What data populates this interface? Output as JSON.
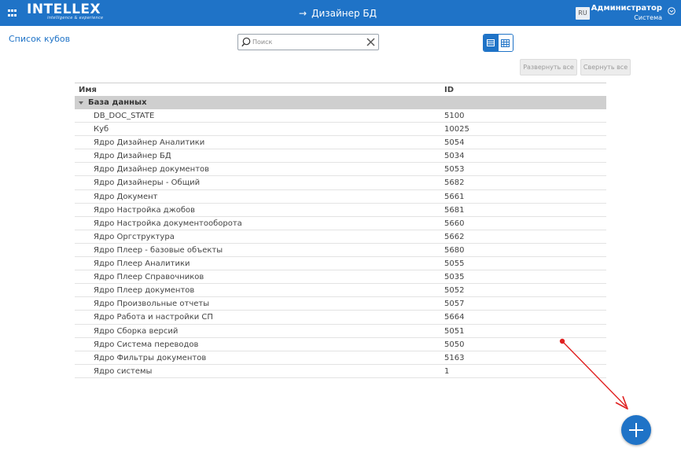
{
  "app": {
    "logo_text": "INTELLEX",
    "logo_tagline": "intelligence & experience",
    "title_arrow": "→",
    "title": "Дизайнер БД",
    "lang": "RU",
    "user_name": "Администратор",
    "user_role": "Система"
  },
  "page": {
    "link": "Список кубов"
  },
  "search": {
    "placeholder": "Поиск",
    "value": ""
  },
  "toolbar": {
    "expand_all": "Развернуть все",
    "collapse_all": "Свернуть все"
  },
  "table": {
    "columns": [
      "Имя",
      "ID"
    ],
    "group": "База данных",
    "rows": [
      {
        "name": "DB_DOC_STATE",
        "id": "5100"
      },
      {
        "name": "Куб",
        "id": "10025"
      },
      {
        "name": "Ядро Дизайнер Аналитики",
        "id": "5054"
      },
      {
        "name": "Ядро Дизайнер БД",
        "id": "5034"
      },
      {
        "name": "Ядро Дизайнер документов",
        "id": "5053"
      },
      {
        "name": "Ядро Дизайнеры - Общий",
        "id": "5682"
      },
      {
        "name": "Ядро Документ",
        "id": "5661"
      },
      {
        "name": "Ядро Настройка джобов",
        "id": "5681"
      },
      {
        "name": "Ядро Настройка документооборота",
        "id": "5660"
      },
      {
        "name": "Ядро Оргструктура",
        "id": "5662"
      },
      {
        "name": "Ядро Плеер - базовые объекты",
        "id": "5680"
      },
      {
        "name": "Ядро Плеер Аналитики",
        "id": "5055"
      },
      {
        "name": "Ядро Плеер Справочников",
        "id": "5035"
      },
      {
        "name": "Ядро Плеер документов",
        "id": "5052"
      },
      {
        "name": "Ядро Произвольные отчеты",
        "id": "5057"
      },
      {
        "name": "Ядро Работа и настройки СП",
        "id": "5664"
      },
      {
        "name": "Ядро Сборка версий",
        "id": "5051"
      },
      {
        "name": "Ядро Система переводов",
        "id": "5050"
      },
      {
        "name": "Ядро Фильтры документов",
        "id": "5163"
      },
      {
        "name": "Ядро системы",
        "id": "1"
      }
    ]
  },
  "colors": {
    "accent": "#1f73c7",
    "annotation_arrow": "#e02020"
  },
  "icons": {
    "apps": "apps-grid-icon",
    "search": "search-icon",
    "clear": "close-icon",
    "list_view": "list-view-icon",
    "grid_view": "grid-view-icon",
    "add": "plus-icon",
    "user_menu": "chevron-down-icon"
  }
}
